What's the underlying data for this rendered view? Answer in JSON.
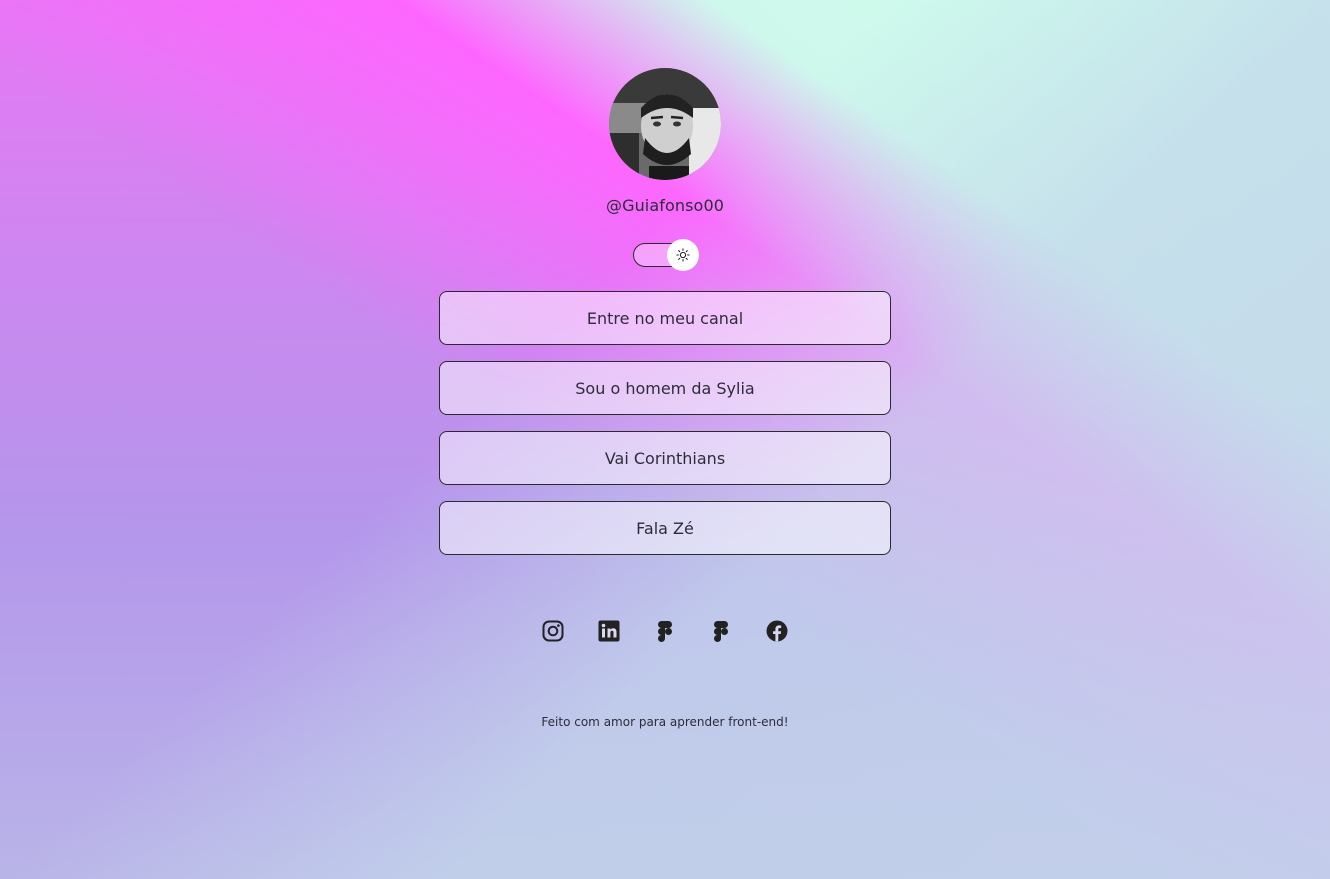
{
  "profile": {
    "username": "@Guiafonso00",
    "avatar_alt": "profile photo"
  },
  "theme_switch": {
    "icon": "sun-icon",
    "state": "light"
  },
  "links": [
    {
      "label": "Entre no meu canal"
    },
    {
      "label": "Sou o homem da Sylia"
    },
    {
      "label": "Vai Corinthians"
    },
    {
      "label": "Fala Zé"
    }
  ],
  "socials": [
    {
      "icon": "instagram-icon"
    },
    {
      "icon": "linkedin-icon"
    },
    {
      "icon": "figma-icon"
    },
    {
      "icon": "figma-icon"
    },
    {
      "icon": "facebook-icon"
    }
  ],
  "footer": {
    "text": "Feito com amor para aprender front-end!"
  },
  "colors": {
    "pink": "#ff65ff",
    "mint": "#cdffec",
    "lavender": "#b9b3e6",
    "text": "#2d2d3a"
  }
}
